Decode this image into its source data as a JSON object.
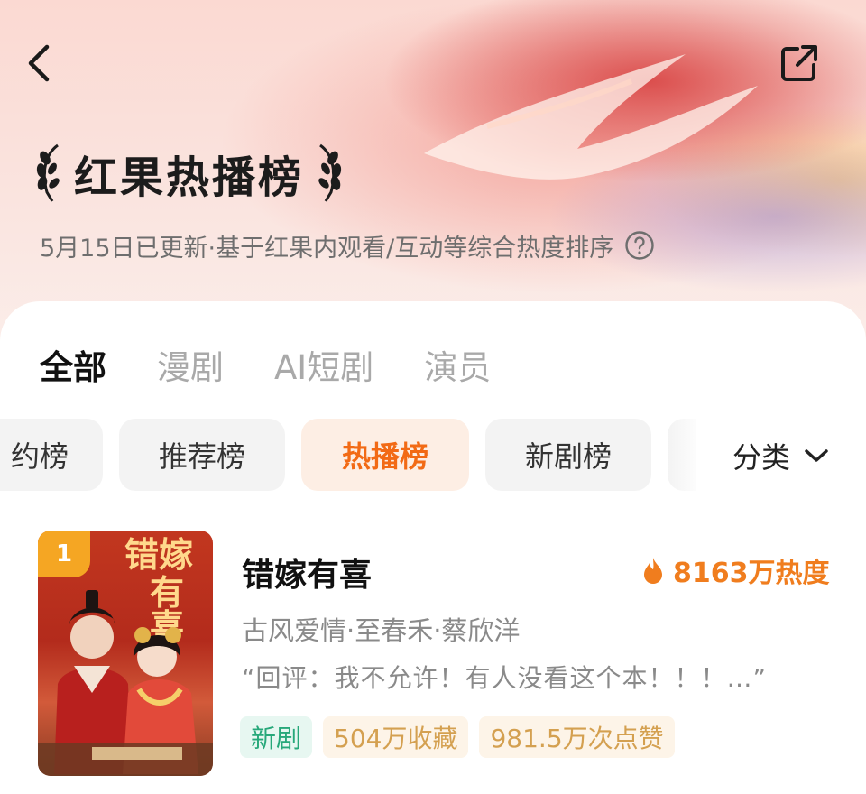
{
  "header": {
    "back_icon": "chevron-left-icon",
    "share_icon": "share-icon",
    "title": "红果热播榜",
    "subtitle": "5月15日已更新·基于红果内观看/互动等综合热度排序",
    "help_icon": "question-circle-icon"
  },
  "tabs": [
    {
      "label": "全部",
      "active": true
    },
    {
      "label": "漫剧",
      "active": false
    },
    {
      "label": "AI短剧",
      "active": false
    },
    {
      "label": "演员",
      "active": false
    }
  ],
  "chips": [
    {
      "label": "约榜",
      "active": false
    },
    {
      "label": "推荐榜",
      "active": false
    },
    {
      "label": "热播榜",
      "active": true
    },
    {
      "label": "新剧榜",
      "active": false
    }
  ],
  "category": {
    "label": "分类",
    "icon": "chevron-down-icon"
  },
  "list": [
    {
      "rank": "1",
      "poster_title": "错嫁有喜",
      "title": "错嫁有喜",
      "heat": "8163万热度",
      "heat_icon": "flame-icon",
      "meta": "古风爱情·至春禾·蔡欣洋",
      "review": "“回评：我不允许！有人没看这个本！！！…”",
      "tags": [
        "新剧",
        "504万收藏",
        "981.5万次点赞"
      ]
    }
  ],
  "colors": {
    "accent": "#f26a15",
    "heat": "#f07d1e",
    "new_tag": "#27a87a",
    "stat_tag": "#d4a050",
    "rank_badge": "#f5a623"
  }
}
